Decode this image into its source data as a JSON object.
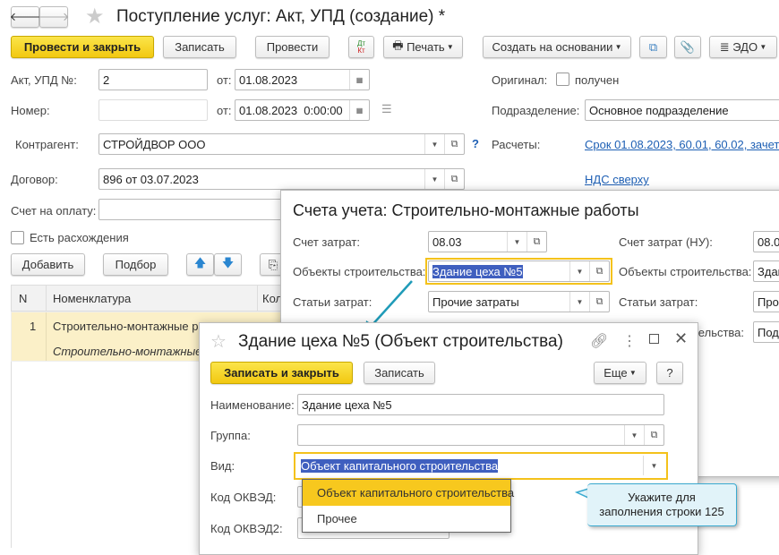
{
  "header": {
    "title": "Поступление услуг: Акт, УПД (создание) *"
  },
  "toolbar": {
    "post_close": "Провести и закрыть",
    "save": "Записать",
    "post": "Провести",
    "dt": "Дт",
    "kt": "Кт",
    "print": "Печать",
    "create_based": "Создать на основании",
    "edo": "ЭДО"
  },
  "form": {
    "act_label": "Акт, УПД №:",
    "act_value": "2",
    "from_label": "от:",
    "act_date": "01.08.2023",
    "number_label": "Номер:",
    "number_value": "",
    "number_date": "01.08.2023  0:00:00",
    "original_label": "Оригинал:",
    "original_checkbox": "получен",
    "division_label": "Подразделение:",
    "division_value": "Основное подразделение",
    "counterparty_label": "Контрагент:",
    "counterparty_value": "СТРОЙДВОР ООО",
    "help": "?",
    "settlements_label": "Расчеты:",
    "settlements_link": "Срок 01.08.2023, 60.01, 60.02, зачет",
    "contract_label": "Договор:",
    "contract_value": "896 от 03.07.2023",
    "vat_link": "НДС сверху",
    "invoice_label": "Счет на оплату:",
    "discrepancy": "Есть расхождения"
  },
  "table": {
    "add": "Добавить",
    "pick": "Подбор",
    "headers": [
      "N",
      "Номенклатура",
      "Кол"
    ],
    "rows": [
      {
        "n": "1",
        "name": "Строительно-монтажные ра",
        "sub": "Строительно-монтажные"
      }
    ]
  },
  "accounts_dialog": {
    "title": "Счета учета: Строительно-монтажные работы",
    "cost_account_label": "Счет затрат:",
    "cost_account": "08.03",
    "objects_label": "Объекты строительства:",
    "objects_value": "Здание цеха №5",
    "cost_items_label": "Статьи затрат:",
    "cost_items_value": "Прочие затраты",
    "cost_account_nu_label": "Счет затрат (НУ):",
    "cost_account_nu": "08.0",
    "objects_nu_value": "Здан",
    "cost_items_nu_value": "Проч",
    "objects2_label": "тельства:",
    "objects2_value": "Под"
  },
  "object_dialog": {
    "title": "Здание цеха №5 (Объект строительства)",
    "save_close": "Записать и закрыть",
    "save": "Записать",
    "more": "Еще",
    "help": "?",
    "name_label": "Наименование:",
    "name_value": "Здание цеха №5",
    "group_label": "Группа:",
    "group_value": "",
    "kind_label": "Вид:",
    "kind_value": "Объект капитального строительства",
    "okved_label": "Код ОКВЭД:",
    "okved2_label": "Код ОКВЭД2:",
    "options": [
      "Объект капитального строительства",
      "Прочее"
    ]
  },
  "callout": {
    "line1": "Укажите для",
    "line2": "заполнения строки 125"
  }
}
